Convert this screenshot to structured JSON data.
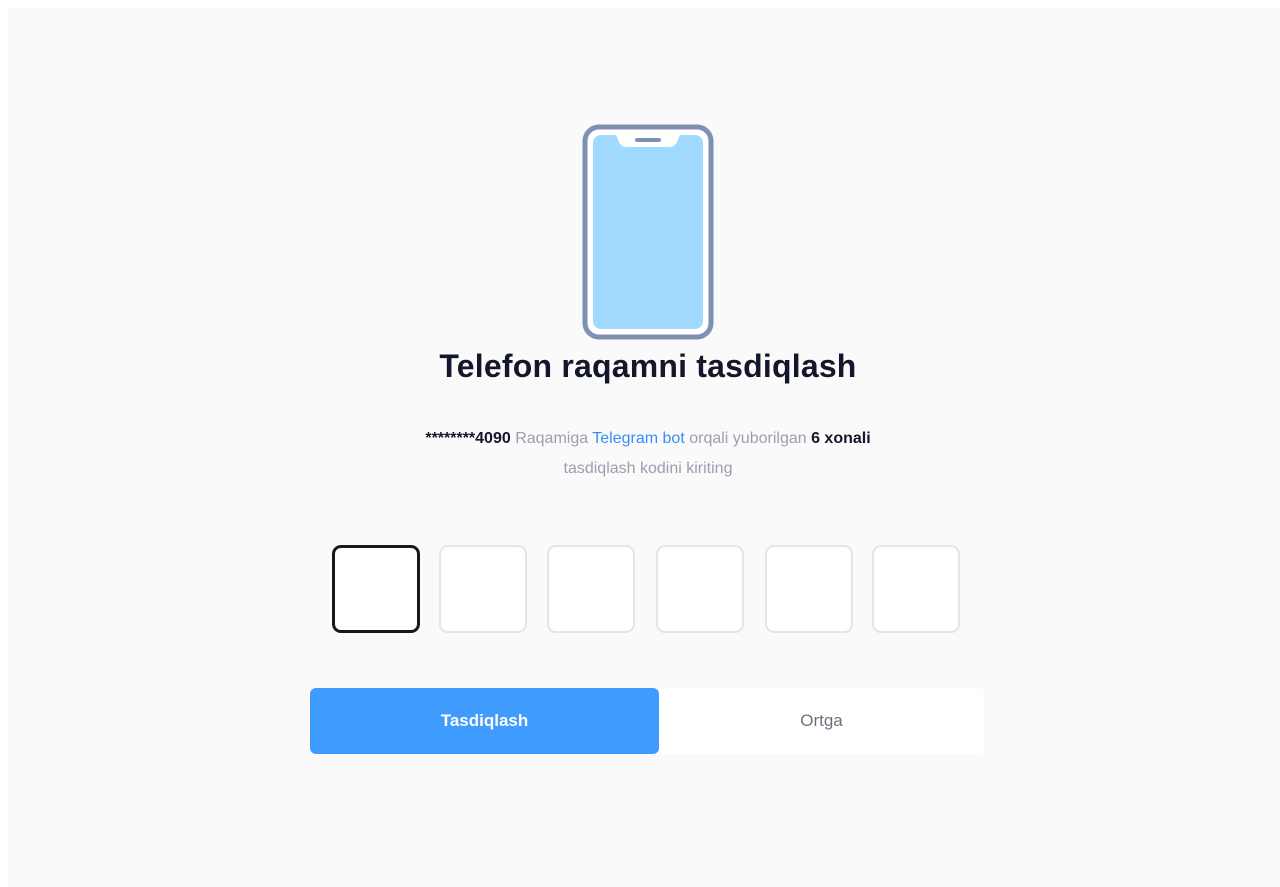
{
  "heading": {
    "title": "Telefon raqamni tasdiqlash"
  },
  "description": {
    "masked_phone": "********4090",
    "text_1": " Raqamiga ",
    "link_text": "Telegram bot",
    "text_2": " orqali yuborilgan ",
    "code_length_text": "6 xonali",
    "text_3": "tasdiqlash kodini kiriting"
  },
  "otp": {
    "digits": [
      "",
      "",
      "",
      "",
      "",
      ""
    ],
    "active_index": 0
  },
  "buttons": {
    "confirm_label": "Tasdiqlash",
    "back_label": "Ortga"
  },
  "icons": {
    "illustration": "smartphone-icon"
  },
  "colors": {
    "primary": "#409bff",
    "link": "#3b8df5",
    "phone_screen": "#a0daff",
    "phone_frame": "#7f90b0",
    "title": "#14162b",
    "muted": "#9a9fad",
    "background": "#fafafa"
  }
}
